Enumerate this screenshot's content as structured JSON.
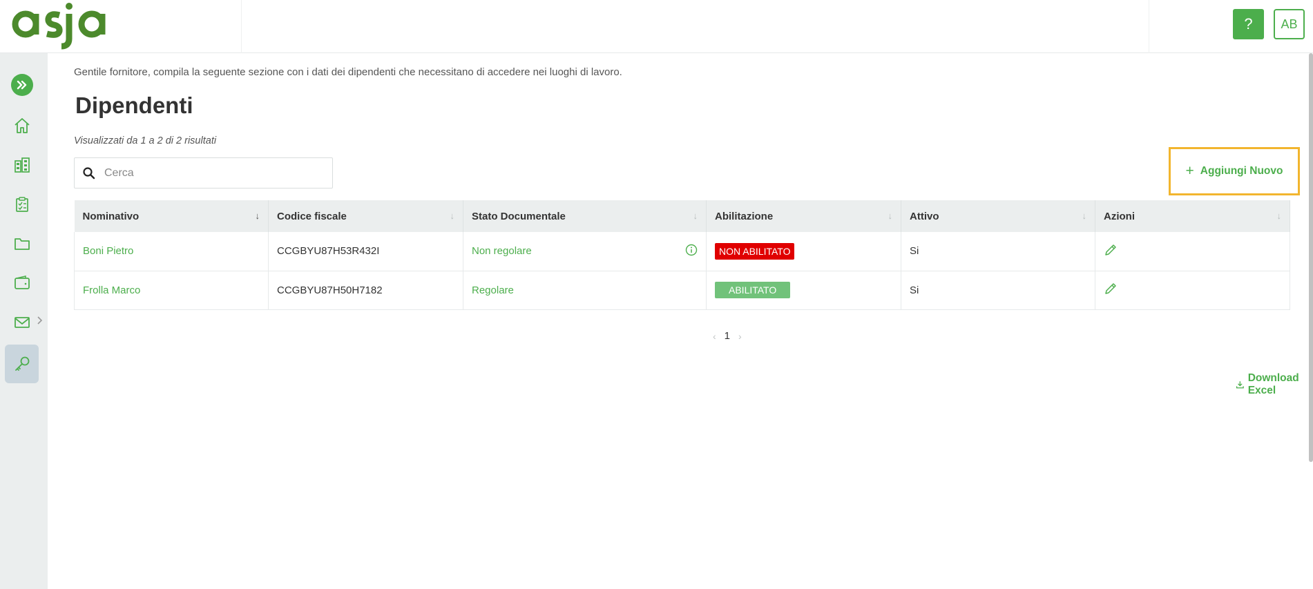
{
  "header": {
    "logo_text": "asja",
    "help_label": "?",
    "avatar_initials": "AB"
  },
  "page": {
    "intro": "Gentile fornitore, compila la seguente sezione con i dati dei dipendenti che necessitano di accedere nei luoghi di lavoro.",
    "title": "Dipendenti",
    "results": "Visualizzati da 1 a 2 di 2 risultati",
    "search_placeholder": "Cerca",
    "add_label": "Aggiungi Nuovo",
    "download_label": "Download Excel",
    "current_page": "1"
  },
  "table": {
    "columns": [
      "Nominativo",
      "Codice fiscale",
      "Stato Documentale",
      "Abilitazione",
      "Attivo",
      "Azioni"
    ],
    "rows": [
      {
        "nominativo": "Boni Pietro",
        "codice_fiscale": "CCGBYU87H53R432I",
        "stato": "Non regolare",
        "abilitazione": "NON ABILITATO",
        "attivo": "Si"
      },
      {
        "nominativo": "Frolla Marco",
        "codice_fiscale": "CCGBYU87H50H7182",
        "stato": "Regolare",
        "abilitazione": "ABILITATO",
        "attivo": "Si"
      }
    ]
  },
  "sidebar": {
    "items": [
      "home-icon",
      "buildings-icon",
      "checklist-icon",
      "folder-icon",
      "wallet-icon",
      "mail-icon",
      "key-icon"
    ]
  },
  "colors": {
    "accent": "#4cae4c",
    "highlight": "#f2b52e",
    "danger": "#e00000",
    "success_badge": "#71c27a"
  }
}
